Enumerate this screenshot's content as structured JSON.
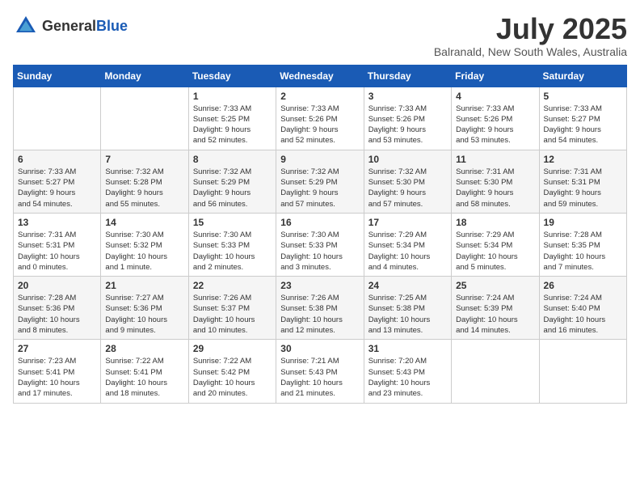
{
  "header": {
    "logo_general": "General",
    "logo_blue": "Blue",
    "month_title": "July 2025",
    "location": "Balranald, New South Wales, Australia"
  },
  "weekdays": [
    "Sunday",
    "Monday",
    "Tuesday",
    "Wednesday",
    "Thursday",
    "Friday",
    "Saturday"
  ],
  "weeks": [
    [
      {
        "day": "",
        "info": ""
      },
      {
        "day": "",
        "info": ""
      },
      {
        "day": "1",
        "info": "Sunrise: 7:33 AM\nSunset: 5:25 PM\nDaylight: 9 hours\nand 52 minutes."
      },
      {
        "day": "2",
        "info": "Sunrise: 7:33 AM\nSunset: 5:26 PM\nDaylight: 9 hours\nand 52 minutes."
      },
      {
        "day": "3",
        "info": "Sunrise: 7:33 AM\nSunset: 5:26 PM\nDaylight: 9 hours\nand 53 minutes."
      },
      {
        "day": "4",
        "info": "Sunrise: 7:33 AM\nSunset: 5:26 PM\nDaylight: 9 hours\nand 53 minutes."
      },
      {
        "day": "5",
        "info": "Sunrise: 7:33 AM\nSunset: 5:27 PM\nDaylight: 9 hours\nand 54 minutes."
      }
    ],
    [
      {
        "day": "6",
        "info": "Sunrise: 7:33 AM\nSunset: 5:27 PM\nDaylight: 9 hours\nand 54 minutes."
      },
      {
        "day": "7",
        "info": "Sunrise: 7:32 AM\nSunset: 5:28 PM\nDaylight: 9 hours\nand 55 minutes."
      },
      {
        "day": "8",
        "info": "Sunrise: 7:32 AM\nSunset: 5:29 PM\nDaylight: 9 hours\nand 56 minutes."
      },
      {
        "day": "9",
        "info": "Sunrise: 7:32 AM\nSunset: 5:29 PM\nDaylight: 9 hours\nand 57 minutes."
      },
      {
        "day": "10",
        "info": "Sunrise: 7:32 AM\nSunset: 5:30 PM\nDaylight: 9 hours\nand 57 minutes."
      },
      {
        "day": "11",
        "info": "Sunrise: 7:31 AM\nSunset: 5:30 PM\nDaylight: 9 hours\nand 58 minutes."
      },
      {
        "day": "12",
        "info": "Sunrise: 7:31 AM\nSunset: 5:31 PM\nDaylight: 9 hours\nand 59 minutes."
      }
    ],
    [
      {
        "day": "13",
        "info": "Sunrise: 7:31 AM\nSunset: 5:31 PM\nDaylight: 10 hours\nand 0 minutes."
      },
      {
        "day": "14",
        "info": "Sunrise: 7:30 AM\nSunset: 5:32 PM\nDaylight: 10 hours\nand 1 minute."
      },
      {
        "day": "15",
        "info": "Sunrise: 7:30 AM\nSunset: 5:33 PM\nDaylight: 10 hours\nand 2 minutes."
      },
      {
        "day": "16",
        "info": "Sunrise: 7:30 AM\nSunset: 5:33 PM\nDaylight: 10 hours\nand 3 minutes."
      },
      {
        "day": "17",
        "info": "Sunrise: 7:29 AM\nSunset: 5:34 PM\nDaylight: 10 hours\nand 4 minutes."
      },
      {
        "day": "18",
        "info": "Sunrise: 7:29 AM\nSunset: 5:34 PM\nDaylight: 10 hours\nand 5 minutes."
      },
      {
        "day": "19",
        "info": "Sunrise: 7:28 AM\nSunset: 5:35 PM\nDaylight: 10 hours\nand 7 minutes."
      }
    ],
    [
      {
        "day": "20",
        "info": "Sunrise: 7:28 AM\nSunset: 5:36 PM\nDaylight: 10 hours\nand 8 minutes."
      },
      {
        "day": "21",
        "info": "Sunrise: 7:27 AM\nSunset: 5:36 PM\nDaylight: 10 hours\nand 9 minutes."
      },
      {
        "day": "22",
        "info": "Sunrise: 7:26 AM\nSunset: 5:37 PM\nDaylight: 10 hours\nand 10 minutes."
      },
      {
        "day": "23",
        "info": "Sunrise: 7:26 AM\nSunset: 5:38 PM\nDaylight: 10 hours\nand 12 minutes."
      },
      {
        "day": "24",
        "info": "Sunrise: 7:25 AM\nSunset: 5:38 PM\nDaylight: 10 hours\nand 13 minutes."
      },
      {
        "day": "25",
        "info": "Sunrise: 7:24 AM\nSunset: 5:39 PM\nDaylight: 10 hours\nand 14 minutes."
      },
      {
        "day": "26",
        "info": "Sunrise: 7:24 AM\nSunset: 5:40 PM\nDaylight: 10 hours\nand 16 minutes."
      }
    ],
    [
      {
        "day": "27",
        "info": "Sunrise: 7:23 AM\nSunset: 5:41 PM\nDaylight: 10 hours\nand 17 minutes."
      },
      {
        "day": "28",
        "info": "Sunrise: 7:22 AM\nSunset: 5:41 PM\nDaylight: 10 hours\nand 18 minutes."
      },
      {
        "day": "29",
        "info": "Sunrise: 7:22 AM\nSunset: 5:42 PM\nDaylight: 10 hours\nand 20 minutes."
      },
      {
        "day": "30",
        "info": "Sunrise: 7:21 AM\nSunset: 5:43 PM\nDaylight: 10 hours\nand 21 minutes."
      },
      {
        "day": "31",
        "info": "Sunrise: 7:20 AM\nSunset: 5:43 PM\nDaylight: 10 hours\nand 23 minutes."
      },
      {
        "day": "",
        "info": ""
      },
      {
        "day": "",
        "info": ""
      }
    ]
  ]
}
